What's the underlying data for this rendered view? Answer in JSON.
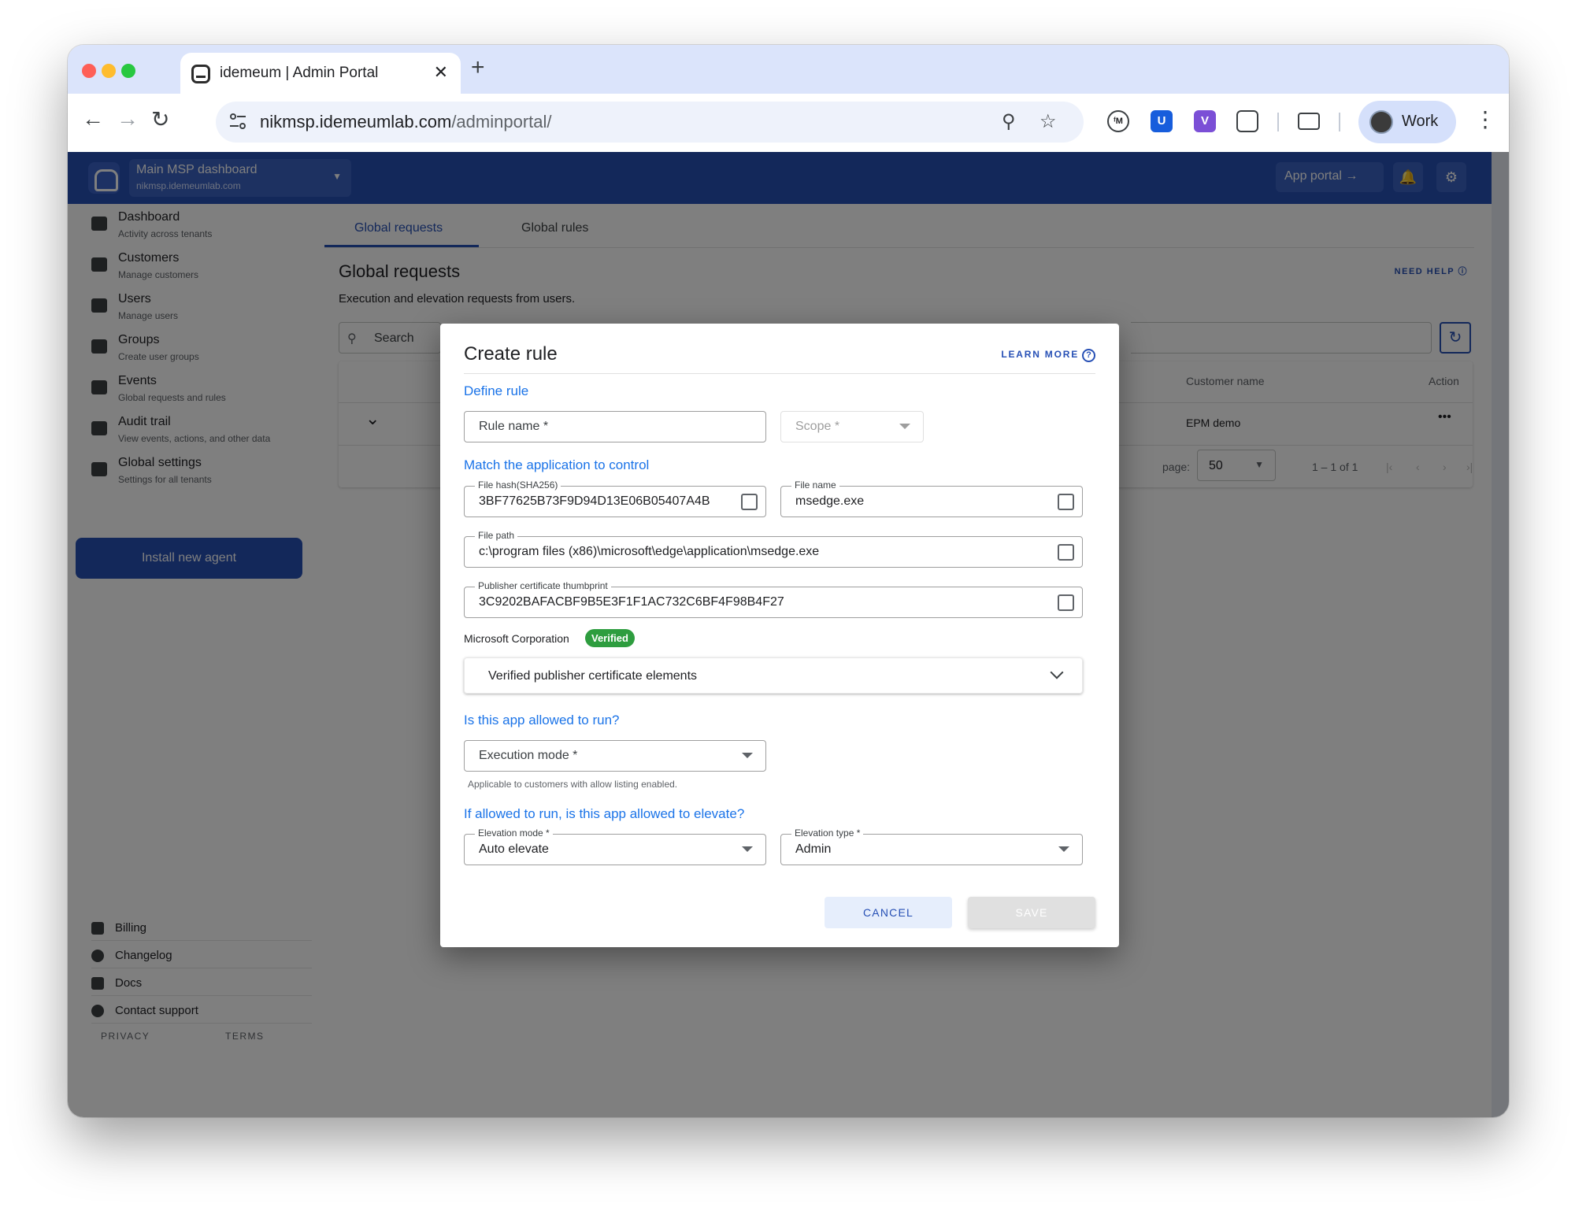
{
  "browser": {
    "tab_title": "idemeum | Admin Portal",
    "url_domain": "nikmsp.idemeumlab.com",
    "url_path": "/adminportal/",
    "profile_label": "Work"
  },
  "app": {
    "org_switcher": {
      "name": "Main MSP dashboard",
      "domain": "nikmsp.idemeumlab.com"
    },
    "app_portal_label": "App portal",
    "sidebar": {
      "items": [
        {
          "label": "Dashboard",
          "sub": "Activity across tenants"
        },
        {
          "label": "Customers",
          "sub": "Manage customers"
        },
        {
          "label": "Users",
          "sub": "Manage users"
        },
        {
          "label": "Groups",
          "sub": "Create user groups"
        },
        {
          "label": "Events",
          "sub": "Global requests and rules"
        },
        {
          "label": "Audit trail",
          "sub": "View events, actions, and other data"
        },
        {
          "label": "Global settings",
          "sub": "Settings for all tenants"
        }
      ],
      "install_button": "Install new agent",
      "bottom": [
        "Billing",
        "Changelog",
        "Docs",
        "Contact support"
      ],
      "privacy": "PRIVACY",
      "terms": "TERMS"
    },
    "tabs": [
      "Global requests",
      "Global rules"
    ],
    "page_title": "Global requests",
    "need_help": "NEED HELP",
    "page_desc": "Execution and elevation requests from users.",
    "search_placeholder": "Search",
    "table": {
      "headers": {
        "customer": "Customer name",
        "action": "Action"
      },
      "rows": [
        {
          "customer": "EPM demo",
          "action": "•••"
        }
      ],
      "per_page_label": "page:",
      "per_page": "50",
      "range": "1 – 1 of 1"
    }
  },
  "modal": {
    "title": "Create rule",
    "learn_more": "LEARN MORE",
    "define_rule": "Define rule",
    "rule_name_placeholder": "Rule name *",
    "scope_placeholder": "Scope *",
    "match_section": "Match the application to control",
    "file_hash": {
      "label": "File hash(SHA256)",
      "value": "3BF77625B73F9D94D13E06B05407A4B"
    },
    "file_name": {
      "label": "File name",
      "value": "msedge.exe"
    },
    "file_path": {
      "label": "File path",
      "value": "c:\\program files (x86)\\microsoft\\edge\\application\\msedge.exe"
    },
    "thumbprint": {
      "label": "Publisher certificate thumbprint",
      "value": "3C9202BAFACBF9B5E3F1F1AC732C6BF4F98B4F27"
    },
    "publisher": "Microsoft Corporation",
    "verified_badge": "Verified",
    "cert_elements": "Verified publisher certificate elements",
    "run_section": "Is this app allowed to run?",
    "execution_mode_placeholder": "Execution mode *",
    "execution_hint": "Applicable to customers with allow listing enabled.",
    "elevate_section": "If allowed to run, is this app allowed to elevate?",
    "elevation_mode": {
      "label": "Elevation mode *",
      "value": "Auto elevate"
    },
    "elevation_type": {
      "label": "Elevation type *",
      "value": "Admin"
    },
    "cancel": "CANCEL",
    "save": "SAVE"
  }
}
